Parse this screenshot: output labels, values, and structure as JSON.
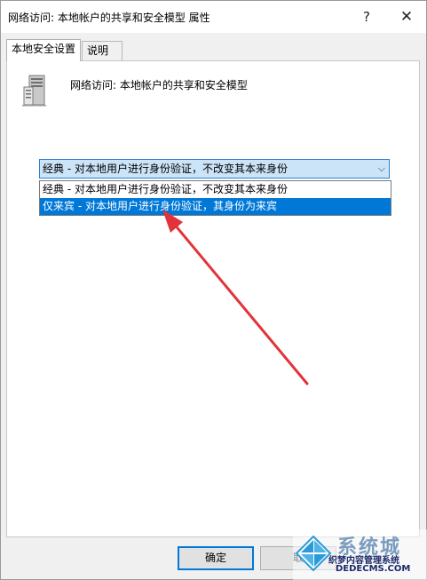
{
  "window": {
    "title": "网络访问: 本地帐户的共享和安全模型 属性",
    "help_glyph": "?",
    "close_glyph": "✕"
  },
  "tabs": [
    {
      "label": "本地安全设置",
      "active": true
    },
    {
      "label": "说明",
      "active": false
    }
  ],
  "policy": {
    "icon": "server-policy-icon",
    "title": "网络访问: 本地帐户的共享和安全模型"
  },
  "select": {
    "value": "经典 - 对本地用户进行身份验证，不改变其本来身份",
    "chevron": "⌵",
    "options": [
      {
        "label": "经典 - 对本地用户进行身份验证，不改变其本来身份",
        "highlighted": false
      },
      {
        "label": "仅来宾 - 对本地用户进行身份验证，其身份为来宾",
        "highlighted": true
      }
    ]
  },
  "annotation": {
    "arrow_color": "#e2333b"
  },
  "buttons": {
    "ok": "确定",
    "cancel": "取"
  },
  "watermark": {
    "brand": "系统城",
    "subtitle": "织梦内容管理系统",
    "url": "DEDECMS.COM"
  },
  "colors": {
    "accent": "#0078d7",
    "select_bg": "#cce4f7"
  }
}
